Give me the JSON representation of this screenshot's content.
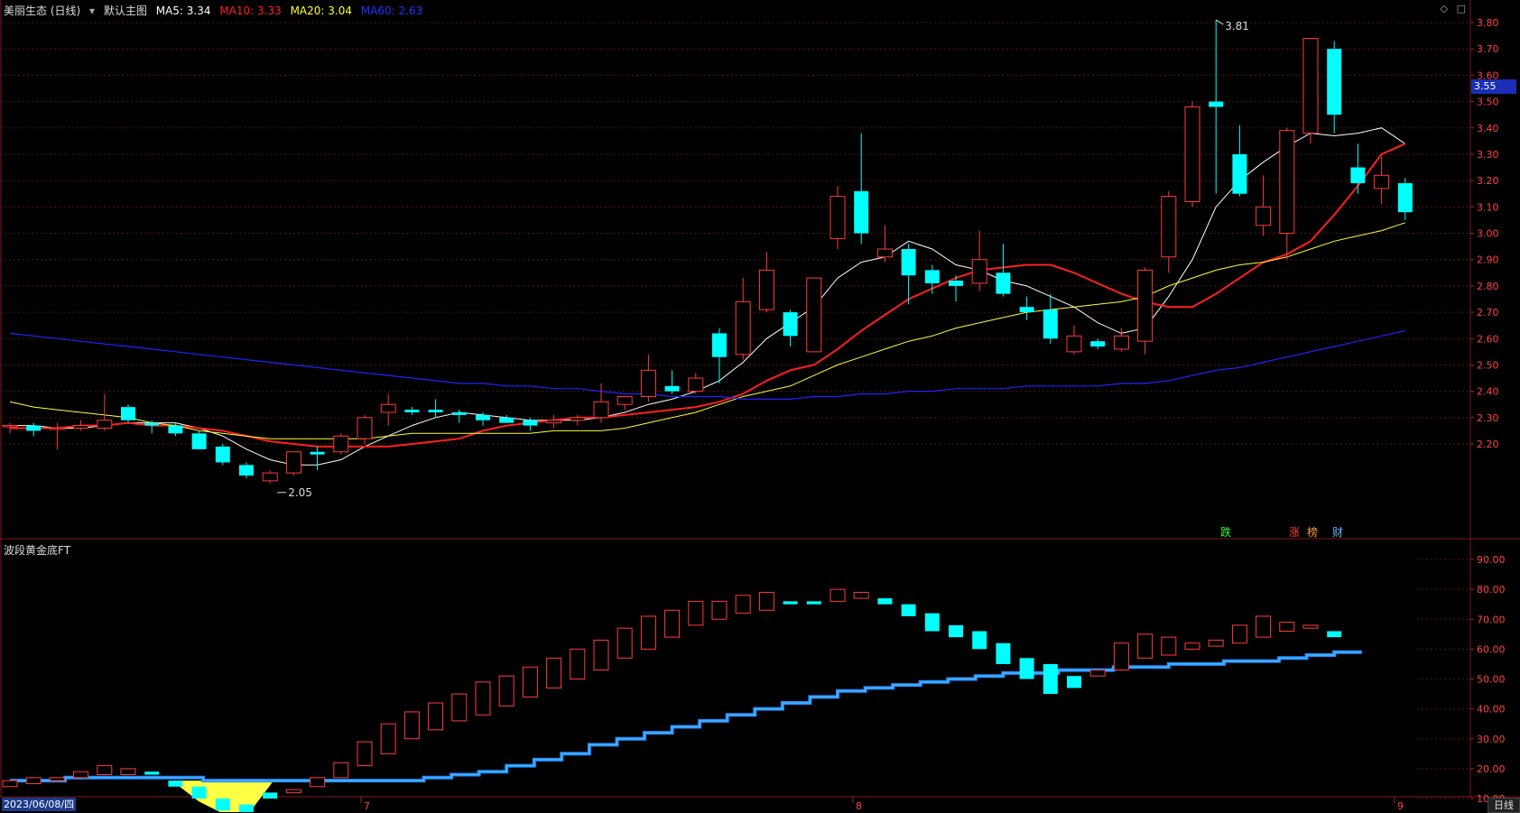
{
  "header": {
    "stock_name": "美丽生态 (日线)",
    "chart_mode": "默认主图",
    "ma5": {
      "label": "MA5: 3.34",
      "color": "#ffffff"
    },
    "ma10": {
      "label": "MA10: 3.33",
      "color": "#ff2020"
    },
    "ma20": {
      "label": "MA20: 3.04",
      "color": "#ffff33"
    },
    "ma60": {
      "label": "MA60: 2.63",
      "color": "#2222ff"
    }
  },
  "icons": {
    "diamond": "diamond-icon",
    "window": "window-icon",
    "dropdown": "chevron-down-icon"
  },
  "current_price": "3.55",
  "indicator_title": "波段黄金底FT",
  "footer": {
    "date": "2023/06/08/四",
    "period": "日线",
    "month_labels": [
      "7",
      "8",
      "9"
    ]
  },
  "markers": [
    "跌",
    "涨",
    "榜",
    "财"
  ],
  "colors": {
    "up": "#ff3b3b",
    "down": "#00ffff",
    "ma5": "#ffffff",
    "ma10": "#ff2020",
    "ma20": "#ffff33",
    "ma60": "#2222ff",
    "grid": "#5a1414",
    "axis_text": "#ff4444"
  },
  "chart_data": [
    {
      "type": "candlestick",
      "title": "美丽生态 (日线)",
      "y_ticks": [
        "3.80",
        "3.70",
        "3.60",
        "3.50",
        "3.40",
        "3.30",
        "3.20",
        "3.10",
        "3.00",
        "2.90",
        "2.80",
        "2.70",
        "2.60",
        "2.50",
        "2.40",
        "2.30",
        "2.20"
      ],
      "ylim": [
        2.0,
        3.85
      ],
      "annotations": [
        {
          "text": "3.81",
          "kind": "high"
        },
        {
          "text": "2.05",
          "kind": "low"
        }
      ],
      "candles": [
        [
          2.27,
          2.28,
          2.24,
          2.27
        ],
        [
          2.27,
          2.28,
          2.23,
          2.25
        ],
        [
          2.26,
          2.28,
          2.18,
          2.26
        ],
        [
          2.26,
          2.29,
          2.25,
          2.27
        ],
        [
          2.26,
          2.39,
          2.25,
          2.29
        ],
        [
          2.34,
          2.35,
          2.28,
          2.29
        ],
        [
          2.28,
          2.29,
          2.24,
          2.27
        ],
        [
          2.27,
          2.28,
          2.23,
          2.24
        ],
        [
          2.24,
          2.25,
          2.19,
          2.18
        ],
        [
          2.19,
          2.2,
          2.12,
          2.13
        ],
        [
          2.12,
          2.13,
          2.07,
          2.08
        ],
        [
          2.06,
          2.1,
          2.05,
          2.09
        ],
        [
          2.09,
          2.17,
          2.08,
          2.17
        ],
        [
          2.17,
          2.19,
          2.1,
          2.16
        ],
        [
          2.17,
          2.24,
          2.16,
          2.23
        ],
        [
          2.22,
          2.31,
          2.2,
          2.3
        ],
        [
          2.32,
          2.39,
          2.27,
          2.35
        ],
        [
          2.33,
          2.34,
          2.31,
          2.32
        ],
        [
          2.33,
          2.37,
          2.3,
          2.32
        ],
        [
          2.32,
          2.33,
          2.28,
          2.31
        ],
        [
          2.31,
          2.32,
          2.27,
          2.29
        ],
        [
          2.3,
          2.31,
          2.28,
          2.28
        ],
        [
          2.29,
          2.3,
          2.25,
          2.27
        ],
        [
          2.28,
          2.31,
          2.26,
          2.29
        ],
        [
          2.29,
          2.31,
          2.27,
          2.3
        ],
        [
          2.3,
          2.43,
          2.28,
          2.36
        ],
        [
          2.35,
          2.38,
          2.33,
          2.38
        ],
        [
          2.38,
          2.54,
          2.36,
          2.48
        ],
        [
          2.42,
          2.48,
          2.39,
          2.4
        ],
        [
          2.4,
          2.47,
          2.39,
          2.45
        ],
        [
          2.62,
          2.64,
          2.43,
          2.53
        ],
        [
          2.54,
          2.83,
          2.52,
          2.74
        ],
        [
          2.71,
          2.93,
          2.7,
          2.86
        ],
        [
          2.7,
          2.71,
          2.57,
          2.61
        ],
        [
          2.55,
          2.83,
          2.55,
          2.83
        ],
        [
          2.98,
          3.18,
          2.94,
          3.14
        ],
        [
          3.16,
          3.38,
          2.96,
          3.0
        ],
        [
          2.91,
          3.03,
          2.89,
          2.94
        ],
        [
          2.94,
          2.96,
          2.73,
          2.84
        ],
        [
          2.86,
          2.88,
          2.77,
          2.81
        ],
        [
          2.82,
          2.84,
          2.74,
          2.8
        ],
        [
          2.81,
          3.01,
          2.78,
          2.9
        ],
        [
          2.85,
          2.96,
          2.76,
          2.77
        ],
        [
          2.72,
          2.76,
          2.67,
          2.7
        ],
        [
          2.71,
          2.77,
          2.58,
          2.6
        ],
        [
          2.55,
          2.65,
          2.54,
          2.61
        ],
        [
          2.59,
          2.6,
          2.56,
          2.57
        ],
        [
          2.56,
          2.64,
          2.55,
          2.61
        ],
        [
          2.59,
          2.87,
          2.54,
          2.86
        ],
        [
          2.91,
          3.16,
          2.85,
          3.14
        ],
        [
          3.12,
          3.5,
          3.1,
          3.48
        ],
        [
          3.5,
          3.81,
          3.15,
          3.48
        ],
        [
          3.3,
          3.41,
          3.14,
          3.15
        ],
        [
          3.03,
          3.22,
          2.99,
          3.1
        ],
        [
          3.0,
          3.4,
          2.9,
          3.39
        ],
        [
          3.38,
          3.74,
          3.34,
          3.74
        ],
        [
          3.7,
          3.73,
          3.38,
          3.45
        ],
        [
          3.25,
          3.34,
          3.15,
          3.19
        ],
        [
          3.17,
          3.29,
          3.11,
          3.22
        ],
        [
          3.19,
          3.21,
          3.05,
          3.08
        ]
      ],
      "series": [
        {
          "name": "MA5",
          "values": [
            2.27,
            2.27,
            2.26,
            2.26,
            2.27,
            2.28,
            2.28,
            2.28,
            2.26,
            2.23,
            2.18,
            2.14,
            2.12,
            2.12,
            2.14,
            2.19,
            2.23,
            2.27,
            2.3,
            2.32,
            2.31,
            2.3,
            2.29,
            2.29,
            2.29,
            2.3,
            2.32,
            2.35,
            2.37,
            2.4,
            2.44,
            2.51,
            2.6,
            2.66,
            2.72,
            2.83,
            2.89,
            2.91,
            2.97,
            2.94,
            2.88,
            2.86,
            2.82,
            2.8,
            2.76,
            2.72,
            2.66,
            2.62,
            2.64,
            2.76,
            2.9,
            3.1,
            3.2,
            3.27,
            3.33,
            3.38,
            3.37,
            3.38,
            3.4,
            3.34
          ]
        },
        {
          "name": "MA10",
          "values": [
            2.26,
            2.26,
            2.26,
            2.27,
            2.27,
            2.28,
            2.27,
            2.27,
            2.26,
            2.25,
            2.23,
            2.21,
            2.2,
            2.19,
            2.19,
            2.19,
            2.19,
            2.2,
            2.21,
            2.22,
            2.25,
            2.27,
            2.28,
            2.29,
            2.3,
            2.3,
            2.31,
            2.32,
            2.33,
            2.34,
            2.36,
            2.39,
            2.44,
            2.48,
            2.5,
            2.56,
            2.63,
            2.69,
            2.75,
            2.79,
            2.83,
            2.86,
            2.87,
            2.88,
            2.88,
            2.85,
            2.81,
            2.77,
            2.74,
            2.72,
            2.72,
            2.77,
            2.83,
            2.89,
            2.92,
            2.97,
            3.07,
            3.18,
            3.3,
            3.34
          ]
        },
        {
          "name": "MA20",
          "values": [
            2.36,
            2.34,
            2.33,
            2.32,
            2.31,
            2.3,
            2.28,
            2.27,
            2.25,
            2.24,
            2.23,
            2.22,
            2.22,
            2.22,
            2.22,
            2.22,
            2.23,
            2.24,
            2.24,
            2.24,
            2.24,
            2.24,
            2.24,
            2.25,
            2.25,
            2.25,
            2.26,
            2.28,
            2.3,
            2.32,
            2.35,
            2.38,
            2.4,
            2.42,
            2.46,
            2.5,
            2.53,
            2.56,
            2.59,
            2.61,
            2.64,
            2.66,
            2.68,
            2.7,
            2.71,
            2.72,
            2.73,
            2.74,
            2.76,
            2.8,
            2.83,
            2.86,
            2.88,
            2.89,
            2.91,
            2.94,
            2.97,
            2.99,
            3.01,
            3.04
          ]
        },
        {
          "name": "MA60",
          "values": [
            2.62,
            2.61,
            2.6,
            2.59,
            2.58,
            2.57,
            2.56,
            2.55,
            2.54,
            2.53,
            2.52,
            2.51,
            2.5,
            2.49,
            2.48,
            2.47,
            2.46,
            2.45,
            2.44,
            2.43,
            2.43,
            2.42,
            2.42,
            2.41,
            2.41,
            2.4,
            2.39,
            2.39,
            2.38,
            2.38,
            2.38,
            2.37,
            2.37,
            2.37,
            2.38,
            2.38,
            2.39,
            2.39,
            2.4,
            2.4,
            2.41,
            2.41,
            2.41,
            2.42,
            2.42,
            2.42,
            2.42,
            2.43,
            2.43,
            2.44,
            2.46,
            2.48,
            2.49,
            2.51,
            2.53,
            2.55,
            2.57,
            2.59,
            2.61,
            2.63
          ]
        }
      ]
    },
    {
      "type": "indicator",
      "title": "波段黄金底FT",
      "y_ticks": [
        "90.00",
        "80.00",
        "70.00",
        "60.00",
        "50.00",
        "40.00",
        "30.00",
        "20.00",
        "10.00"
      ],
      "ylim": [
        0,
        95
      ],
      "boxes": [
        [
          14,
          16,
          "up"
        ],
        [
          15,
          17,
          "up"
        ],
        [
          16,
          17,
          "up"
        ],
        [
          17,
          19,
          "up"
        ],
        [
          18,
          21,
          "up"
        ],
        [
          18,
          20,
          "up"
        ],
        [
          18,
          19,
          "down"
        ],
        [
          14,
          16,
          "down"
        ],
        [
          10,
          14,
          "down"
        ],
        [
          6,
          10,
          "down"
        ],
        [
          4,
          8,
          "down"
        ],
        [
          10,
          12,
          "down"
        ],
        [
          12,
          13,
          "up"
        ],
        [
          14,
          17,
          "up"
        ],
        [
          17,
          22,
          "up"
        ],
        [
          21,
          29,
          "up"
        ],
        [
          25,
          35,
          "up"
        ],
        [
          30,
          39,
          "up"
        ],
        [
          33,
          42,
          "up"
        ],
        [
          36,
          45,
          "up"
        ],
        [
          38,
          49,
          "up"
        ],
        [
          41,
          51,
          "up"
        ],
        [
          44,
          54,
          "up"
        ],
        [
          47,
          57,
          "up"
        ],
        [
          50,
          60,
          "up"
        ],
        [
          53,
          63,
          "up"
        ],
        [
          57,
          67,
          "up"
        ],
        [
          60,
          71,
          "up"
        ],
        [
          64,
          73,
          "up"
        ],
        [
          68,
          76,
          "up"
        ],
        [
          70,
          76,
          "up"
        ],
        [
          72,
          78,
          "up"
        ],
        [
          73,
          79,
          "up"
        ],
        [
          75,
          76,
          "down"
        ],
        [
          75,
          76,
          "down"
        ],
        [
          76,
          80,
          "up"
        ],
        [
          77,
          79,
          "up"
        ],
        [
          75,
          77,
          "down"
        ],
        [
          71,
          75,
          "down"
        ],
        [
          66,
          72,
          "down"
        ],
        [
          64,
          68,
          "down"
        ],
        [
          60,
          66,
          "down"
        ],
        [
          55,
          62,
          "down"
        ],
        [
          50,
          57,
          "down"
        ],
        [
          45,
          55,
          "down"
        ],
        [
          47,
          51,
          "down"
        ],
        [
          51,
          53,
          "up"
        ],
        [
          53,
          62,
          "up"
        ],
        [
          57,
          65,
          "up"
        ],
        [
          58,
          64,
          "up"
        ],
        [
          60,
          62,
          "up"
        ],
        [
          61,
          63,
          "up"
        ],
        [
          62,
          68,
          "up"
        ],
        [
          64,
          71,
          "up"
        ],
        [
          66,
          69,
          "up"
        ],
        [
          67,
          68,
          "up"
        ],
        [
          64,
          66,
          "down"
        ]
      ],
      "series": [
        {
          "name": "",
          "values": [
            16,
            16,
            17,
            17,
            17,
            17,
            17,
            16,
            16,
            16,
            16,
            16,
            16,
            16,
            16,
            17,
            18,
            19,
            21,
            23,
            25,
            28,
            30,
            32,
            34,
            36,
            38,
            40,
            42,
            44,
            46,
            47,
            48,
            49,
            50,
            51,
            52,
            52,
            53,
            53,
            54,
            54,
            55,
            55,
            56,
            56,
            57,
            58,
            59
          ]
        }
      ]
    }
  ]
}
